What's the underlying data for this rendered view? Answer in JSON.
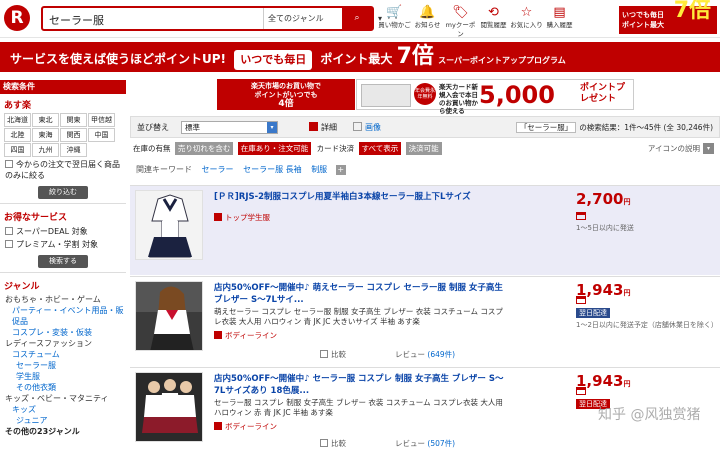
{
  "header": {
    "logo": "R",
    "search_query": "セーラー服",
    "genre": "全てのジャンル",
    "nav": [
      {
        "icon": "cart-icon",
        "label": "買い物かご"
      },
      {
        "icon": "bell-icon",
        "label": "お知らせ"
      },
      {
        "icon": "coupon-icon",
        "label": "myクーポン"
      },
      {
        "icon": "history-icon",
        "label": "閲覧履歴"
      },
      {
        "icon": "star-icon",
        "label": "お気に入り"
      },
      {
        "icon": "receipt-icon",
        "label": "購入履歴"
      }
    ],
    "badge_line1": "いつでも毎日",
    "badge_line2": "ポイント最大",
    "badge_big": "7倍"
  },
  "promo": {
    "text1": "サービスを使えば使うほどポイントUP!",
    "pill": "いつでも毎日",
    "text2": "ポイント最大",
    "num": "7倍",
    "sub": "スーパーポイントアッププログラム"
  },
  "sidebar": {
    "head": "検索条件",
    "region_title": "あす楽",
    "regions": [
      "北海道",
      "東北",
      "関東",
      "甲信越",
      "北陸",
      "東海",
      "関西",
      "中国",
      "四国",
      "九州",
      "沖縄"
    ],
    "next_day": "今からの注文で翌日届く商品のみに絞る",
    "narrow_button": "絞り込む",
    "service_title": "お得なサービス",
    "deal": "スーパーDEAL 対象",
    "premium": "プレミアム・学割 対象",
    "search_button": "検索する",
    "genre_title": "ジャンル",
    "genres": [
      {
        "t": "おもちゃ・ホビー・ゲーム",
        "c": "gen"
      },
      {
        "t": "パーティー・イベント用品・販促品",
        "c": "gen l1"
      },
      {
        "t": "コスプレ・変装・仮装",
        "c": "gen l1"
      },
      {
        "t": "レディースファッション",
        "c": "gen"
      },
      {
        "t": "コスチューム",
        "c": "gen l1"
      },
      {
        "t": "セーラー服",
        "c": "gen l2"
      },
      {
        "t": "学生服",
        "c": "gen l2"
      },
      {
        "t": "その他衣類",
        "c": "gen l2"
      },
      {
        "t": "キッズ・ベビー・マタニティ",
        "c": "gen"
      },
      {
        "t": "キッズ",
        "c": "gen l1"
      },
      {
        "t": "ジュニア",
        "c": "gen l2"
      },
      {
        "t": "その他の23ジャンル",
        "c": "gen b"
      }
    ]
  },
  "banners": {
    "b1_line1": "楽天市場のお買い物で",
    "b1_line2": "ポイントがいつでも",
    "b1_line3": "4倍",
    "b2_circle": "年会費永年無料",
    "b2_text": "楽天カード新規入会で本日のお買い物から使える",
    "b2_points": "5,000",
    "b2_pp": "ポイントプレゼント"
  },
  "sort": {
    "label": "並び替え",
    "selected": "標準",
    "detail": "詳細",
    "image": "画像",
    "query_tag": "「セーラー服」",
    "results": "の検索結果：1件〜45件 (全 30,246件)"
  },
  "filters": {
    "stock_label": "在庫の有無",
    "exclude_sold": "売り切れを含む",
    "in_stock": "在庫あり・注文可能",
    "card_label": "カード決済",
    "all": "すべて表示",
    "card_ok": "決済可能",
    "icon_help": "アイコンの説明"
  },
  "keywords": {
    "label": "関連キーワード",
    "items": [
      "セーラー",
      "セーラー服 長袖",
      "制服"
    ]
  },
  "items": [
    {
      "title": "[ＰＲ]RJS-2制服コスプレ用夏半袖白3本線セーラー服上下Lサイズ",
      "desc": "",
      "shop": "トップ学生服",
      "price": "2,700",
      "unit": "円",
      "ship": "1〜5日以内に発送",
      "review": "",
      "count": ""
    },
    {
      "title": "店内50%OFF〜開催中♪ 萌えセーラー コスプレ セーラー服 制服 女子高生 ブレザー S〜7Lサイ...",
      "desc": "萌えセーラー コスプレ セーラー服 制服 女子高生 ブレザー 衣装 コスチューム コスプレ衣装 大人用 ハロウィン 青 JK JC 大きいサイズ 半袖 あす楽",
      "shop": "ボディーライン",
      "price": "1,943",
      "unit": "円",
      "ship": "1〜2日以内に発送予定（店舗休業日を除く）",
      "badge": "翌日配達",
      "review": "比較",
      "revlabel": "レビュー",
      "count": "(649件)"
    },
    {
      "title": "店内50%OFF〜開催中♪ セーラー服 コスプレ 制服 女子高生 ブレザー S〜7Lサイズあり 18色展...",
      "desc": "セーラー服 コスプレ 制服 女子高生 ブレザー 衣装 コスチューム コスプレ衣装 大人用 ハロウィン 赤 青 JK JC 半袖 あす楽",
      "shop": "ボディーライン",
      "price": "1,943",
      "unit": "円",
      "ship": "",
      "badge": "翌日配達",
      "review": "比較",
      "revlabel": "レビュー",
      "count": "(507件)"
    }
  ],
  "watermark": "知乎 @风独赏猪",
  "colors": {
    "brand": "#bf0000",
    "link": "#0a44a8"
  }
}
